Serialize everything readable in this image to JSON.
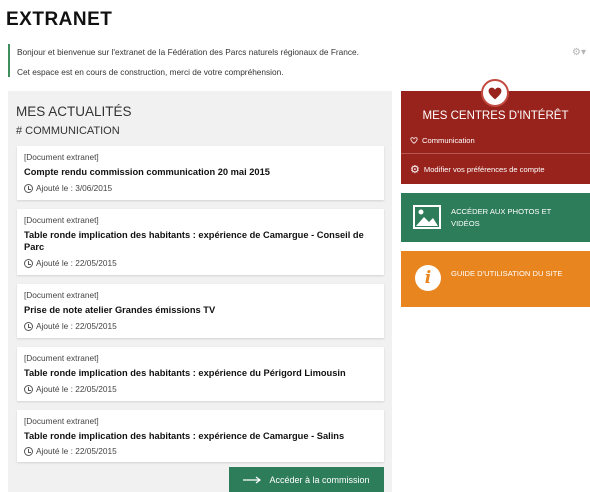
{
  "header": {
    "title": "EXTRANET",
    "welcome_line_1": "Bonjour et bienvenue sur l'extranet de la Fédération des Parcs naturels régionaux de France.",
    "welcome_line_2": "Cet espace est en cours de construction, merci de votre compréhension."
  },
  "news": {
    "title": "MES ACTUALITÉS",
    "subtitle": "# COMMUNICATION",
    "items": [
      {
        "type": "[Document extranet]",
        "title": "Compte rendu commission communication 20 mai 2015",
        "date": "Ajouté le : 3/06/2015"
      },
      {
        "type": "[Document extranet]",
        "title": "Table ronde implication des habitants : expérience de Camargue - Conseil de Parc",
        "date": "Ajouté le : 22/05/2015"
      },
      {
        "type": "[Document extranet]",
        "title": "Prise de note atelier Grandes émissions TV",
        "date": "Ajouté le : 22/05/2015"
      },
      {
        "type": "[Document extranet]",
        "title": "Table ronde implication des habitants : expérience du Périgord Limousin",
        "date": "Ajouté le : 22/05/2015"
      },
      {
        "type": "[Document extranet]",
        "title": "Table ronde implication des habitants : expérience de Camargue - Salins",
        "date": "Ajouté le : 22/05/2015"
      }
    ],
    "commission_button": "Accéder à la commission"
  },
  "interests": {
    "title": "MES CENTRES D'INTÉRÊT",
    "item": "Communication",
    "preferences_link": "Modifier vos préférences de compte"
  },
  "tiles": {
    "photos": "ACCÉDER AUX PHOTOS ET VIDÉOS",
    "guide": "GUIDE D'UTILISATION DU SITE"
  },
  "colors": {
    "green": "#2e7d5a",
    "red": "#98231c",
    "orange": "#e8851f"
  },
  "icons": {
    "heart": "heart-icon",
    "clock": "clock-icon",
    "arrow": "arrow-right-icon",
    "gear": "gear-icon",
    "image": "image-icon",
    "info": "info-icon"
  }
}
